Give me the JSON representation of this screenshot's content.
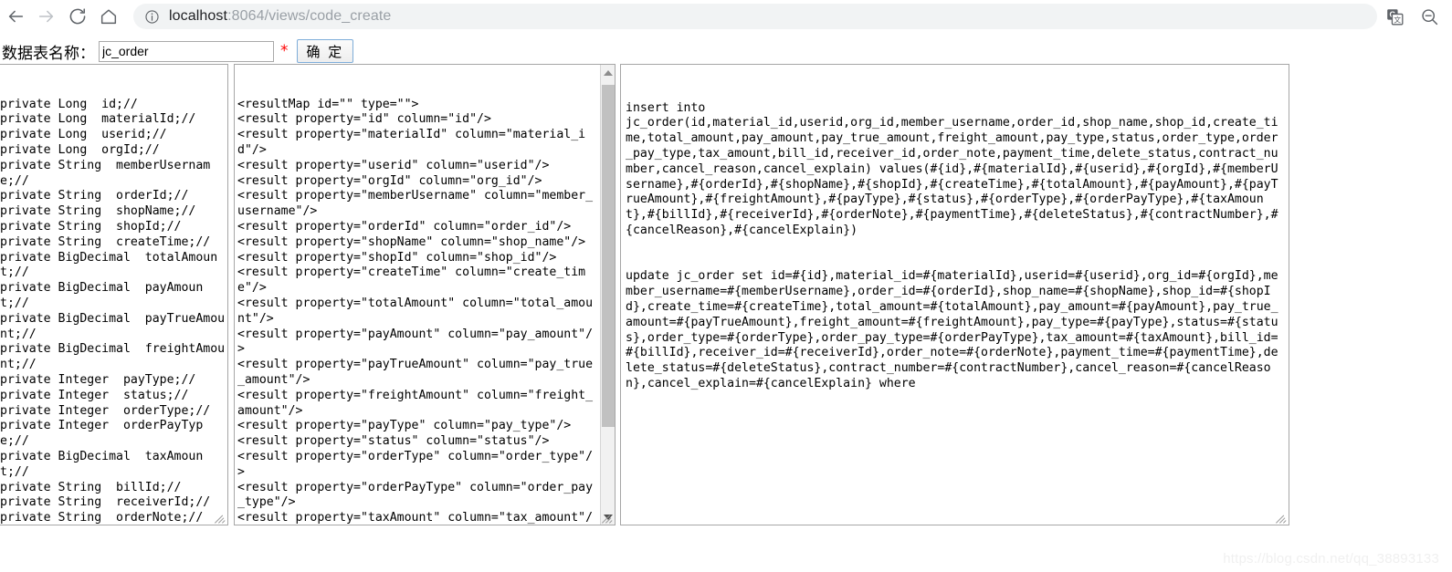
{
  "browser": {
    "back_label": "Back",
    "forward_label": "Forward",
    "reload_label": "Reload",
    "home_label": "Home",
    "site_info_label": "View site information",
    "url_host": "localhost",
    "url_path": ":8064/views/code_create",
    "url_full": "localhost:8064/views/code_create",
    "translate_label": "Translate this page",
    "zoom_label": "Search"
  },
  "form": {
    "label": "数据表名称：",
    "table_name_value": "jc_order",
    "table_name_placeholder": "",
    "required_mark": "*",
    "confirm_label": "确 定"
  },
  "panels": {
    "fields": {
      "name": "entity-fields",
      "content": "private Long  id;//\nprivate Long  materialId;//\nprivate Long  userid;//\nprivate Long  orgId;//\nprivate String  memberUsername;//\nprivate String  orderId;//\nprivate String  shopName;//\nprivate String  shopId;//\nprivate String  createTime;//\nprivate BigDecimal  totalAmount;//\nprivate BigDecimal  payAmount;//\nprivate BigDecimal  payTrueAmount;//\nprivate BigDecimal  freightAmount;//\nprivate Integer  payType;//\nprivate Integer  status;//\nprivate Integer  orderType;//\nprivate Integer  orderPayType;//\nprivate BigDecimal  taxAmount;//\nprivate String  billId;//\nprivate String  receiverId;//\nprivate String  orderNote;//\nprivate String  paymentTime;//\nprivate Integer  deleteStatus;//\nprivate String  contractNumber;//\nprivate Integer  cancelReason;//\nprivate String  cancelExplain;//"
    },
    "resultmap": {
      "name": "mybatis-resultmap",
      "content": "<resultMap id=\"\" type=\"\">\n<result property=\"id\" column=\"id\"/>\n<result property=\"materialId\" column=\"material_id\"/>\n<result property=\"userid\" column=\"userid\"/>\n<result property=\"orgId\" column=\"org_id\"/>\n<result property=\"memberUsername\" column=\"member_username\"/>\n<result property=\"orderId\" column=\"order_id\"/>\n<result property=\"shopName\" column=\"shop_name\"/>\n<result property=\"shopId\" column=\"shop_id\"/>\n<result property=\"createTime\" column=\"create_time\"/>\n<result property=\"totalAmount\" column=\"total_amount\"/>\n<result property=\"payAmount\" column=\"pay_amount\"/>\n<result property=\"payTrueAmount\" column=\"pay_true_amount\"/>\n<result property=\"freightAmount\" column=\"freight_amount\"/>\n<result property=\"payType\" column=\"pay_type\"/>\n<result property=\"status\" column=\"status\"/>\n<result property=\"orderType\" column=\"order_type\"/>\n<result property=\"orderPayType\" column=\"order_pay_type\"/>\n<result property=\"taxAmount\" column=\"tax_amount\"/>\n<result property=\"billId\" column=\"bill_id\"/>\n<result property=\"receiverId\" column=\"receiver_id\"/>\n<result property=\"orderNote\" column=\"order_note\"/>\n<result property=\"paymentTime\" column=\"payment_time\"/>\n<result property=\"deleteStatus\""
    },
    "sql": {
      "name": "generated-sql",
      "content": "insert into\njc_order(id,material_id,userid,org_id,member_username,order_id,shop_name,shop_id,create_time,total_amount,pay_amount,pay_true_amount,freight_amount,pay_type,status,order_type,order_pay_type,tax_amount,bill_id,receiver_id,order_note,payment_time,delete_status,contract_number,cancel_reason,cancel_explain) values(#{id},#{materialId},#{userid},#{orgId},#{memberUsername},#{orderId},#{shopName},#{shopId},#{createTime},#{totalAmount},#{payAmount},#{payTrueAmount},#{freightAmount},#{payType},#{status},#{orderType},#{orderPayType},#{taxAmount},#{billId},#{receiverId},#{orderNote},#{paymentTime},#{deleteStatus},#{contractNumber},#{cancelReason},#{cancelExplain})\n\n\nupdate jc_order set id=#{id},material_id=#{materialId},userid=#{userid},org_id=#{orgId},member_username=#{memberUsername},order_id=#{orderId},shop_name=#{shopName},shop_id=#{shopId},create_time=#{createTime},total_amount=#{totalAmount},pay_amount=#{payAmount},pay_true_amount=#{payTrueAmount},freight_amount=#{freightAmount},pay_type=#{payType},status=#{status},order_type=#{orderType},order_pay_type=#{orderPayType},tax_amount=#{taxAmount},bill_id=#{billId},receiver_id=#{receiverId},order_note=#{orderNote},payment_time=#{paymentTime},delete_status=#{deleteStatus},contract_number=#{contractNumber},cancel_reason=#{cancelReason},cancel_explain=#{cancelExplain} where"
    }
  },
  "watermark": "https://blog.csdn.net/qq_38893133"
}
